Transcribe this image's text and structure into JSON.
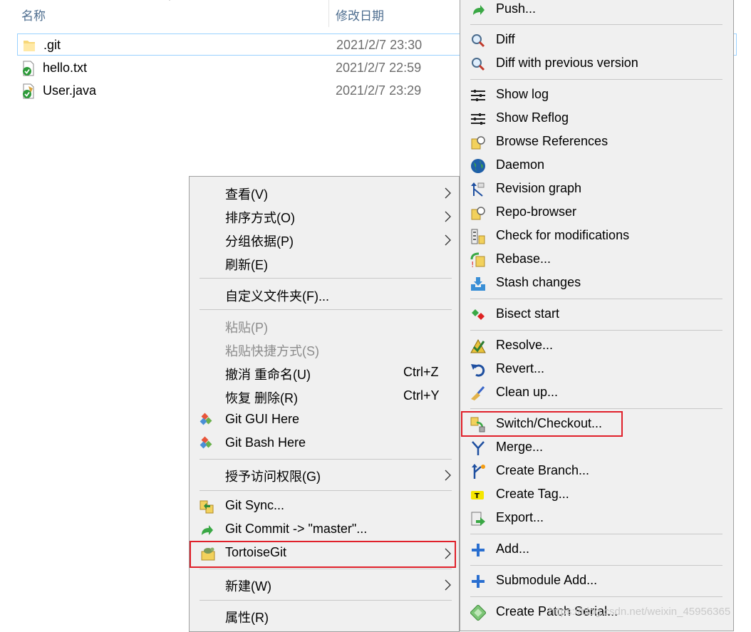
{
  "explorer": {
    "columns": {
      "name": "名称",
      "date": "修改日期"
    },
    "files": [
      {
        "name": ".git",
        "date": "2021/2/7 23:30",
        "icon": "folder-icon"
      },
      {
        "name": "hello.txt",
        "date": "2021/2/7 22:59",
        "icon": "text-file-git-icon"
      },
      {
        "name": "User.java",
        "date": "2021/2/7 23:29",
        "icon": "java-file-git-icon"
      }
    ]
  },
  "context_menu": {
    "items": [
      {
        "label": "查看(V)"
      },
      {
        "label": "排序方式(O)"
      },
      {
        "label": "分组依据(P)"
      },
      {
        "label": "刷新(E)"
      },
      {
        "label": "自定义文件夹(F)..."
      },
      {
        "label": "粘贴(P)"
      },
      {
        "label": "粘贴快捷方式(S)"
      },
      {
        "label": "撤消 重命名(U)",
        "shortcut": "Ctrl+Z"
      },
      {
        "label": "恢复 删除(R)",
        "shortcut": "Ctrl+Y"
      },
      {
        "label": "Git GUI Here"
      },
      {
        "label": "Git Bash Here"
      },
      {
        "label": "授予访问权限(G)"
      },
      {
        "label": "Git Sync..."
      },
      {
        "label": "Git Commit -> \"master\"..."
      },
      {
        "label": "TortoiseGit"
      },
      {
        "label": "新建(W)"
      },
      {
        "label": "属性(R)"
      }
    ]
  },
  "tortoisegit_submenu": {
    "items": [
      {
        "label": "Push..."
      },
      {
        "label": "Diff"
      },
      {
        "label": "Diff with previous version"
      },
      {
        "label": "Show log"
      },
      {
        "label": "Show Reflog"
      },
      {
        "label": "Browse References"
      },
      {
        "label": "Daemon"
      },
      {
        "label": "Revision graph"
      },
      {
        "label": "Repo-browser"
      },
      {
        "label": "Check for modifications"
      },
      {
        "label": "Rebase..."
      },
      {
        "label": "Stash changes"
      },
      {
        "label": "Bisect start"
      },
      {
        "label": "Resolve..."
      },
      {
        "label": "Revert..."
      },
      {
        "label": "Clean up..."
      },
      {
        "label": "Switch/Checkout..."
      },
      {
        "label": "Merge..."
      },
      {
        "label": "Create Branch..."
      },
      {
        "label": "Create Tag..."
      },
      {
        "label": "Export..."
      },
      {
        "label": "Add..."
      },
      {
        "label": "Submodule Add..."
      },
      {
        "label": "Create Patch Serial..."
      }
    ]
  },
  "highlight_color": "#e0202a",
  "watermark": "https://blog.csdn.net/weixin_45956365"
}
